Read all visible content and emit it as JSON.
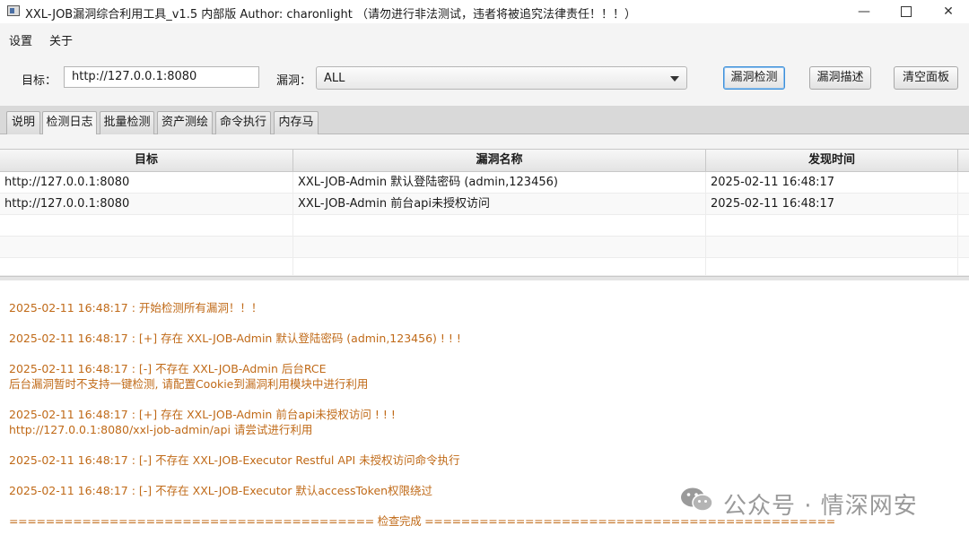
{
  "window": {
    "title": "XXL-JOB漏洞综合利用工具_v1.5 内部版 Author: charonlight     （请勿进行非法测试，违者将被追究法律责任！！！）",
    "controls": {
      "minimize": "—",
      "close": "✕"
    }
  },
  "menu": {
    "items": [
      "设置",
      "关于"
    ]
  },
  "toolbar": {
    "target_label": "目标：",
    "target_value": "http://127.0.0.1:8080",
    "vuln_label": "漏洞：",
    "vuln_selected": "ALL",
    "buttons": {
      "detect": "漏洞检测",
      "describe": "漏洞描述",
      "clear": "清空面板"
    }
  },
  "tabs": [
    "说明",
    "检测日志",
    "批量检测",
    "资产测绘",
    "命令执行",
    "内存马"
  ],
  "active_tab": "检测日志",
  "table": {
    "headers": [
      "目标",
      "漏洞名称",
      "发现时间"
    ],
    "rows": [
      [
        "http://127.0.0.1:8080",
        "XXL-JOB-Admin 默认登陆密码 (admin,123456)",
        "2025-02-11 16:48:17"
      ],
      [
        "http://127.0.0.1:8080",
        "XXL-JOB-Admin 前台api未授权访问",
        "2025-02-11 16:48:17"
      ]
    ]
  },
  "log": {
    "color": "#c06a18",
    "lines": [
      "2025-02-11 16:48:17 : 开始检测所有漏洞！！！",
      "2025-02-11 16:48:17 : [+] 存在 XXL-JOB-Admin 默认登陆密码 (admin,123456) ! ! !",
      "2025-02-11 16:48:17 : [-] 不存在 XXL-JOB-Admin 后台RCE",
      "后台漏洞暂时不支持一键检测, 请配置Cookie到漏洞利用模块中进行利用",
      "2025-02-11 16:48:17 : [+] 存在 XXL-JOB-Admin 前台api未授权访问 ! ! !",
      "http://127.0.0.1:8080/xxl-job-admin/api 请尝试进行利用",
      "2025-02-11 16:48:17 : [-] 不存在 XXL-JOB-Executor Restful API 未授权访问命令执行",
      "2025-02-11 16:48:17 : [-] 不存在 XXL-JOB-Executor 默认accessToken权限绕过",
      "======================================== 检查完成 ============================================="
    ]
  },
  "watermark": {
    "text": "公众号 · 情深网安",
    "icon": "wechat-icon"
  }
}
